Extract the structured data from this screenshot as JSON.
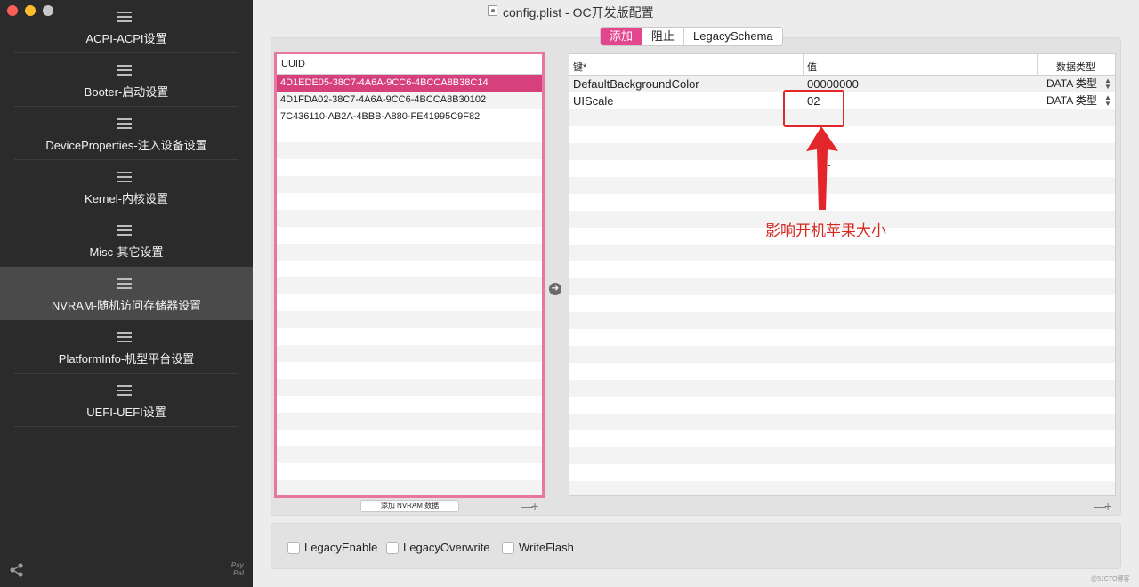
{
  "window": {
    "title": "config.plist - OC开发版配置"
  },
  "sidebar": {
    "items": [
      {
        "label": "ACPI-ACPI设置",
        "active": false
      },
      {
        "label": "Booter-启动设置",
        "active": false
      },
      {
        "label": "DeviceProperties-注入设备设置",
        "active": false
      },
      {
        "label": "Kernel-内核设置",
        "active": false
      },
      {
        "label": "Misc-其它设置",
        "active": false
      },
      {
        "label": "NVRAM-随机访问存储器设置",
        "active": true
      },
      {
        "label": "PlatformInfo-机型平台设置",
        "active": false
      },
      {
        "label": "UEFI-UEFI设置",
        "active": false
      }
    ],
    "paypal": "Pay Pal"
  },
  "tabs": [
    {
      "label": "添加",
      "active": true
    },
    {
      "label": "阻止",
      "active": false
    },
    {
      "label": "LegacySchema",
      "active": false
    }
  ],
  "uuid_table": {
    "header": "UUID",
    "rows": [
      "4D1EDE05-38C7-4A6A-9CC6-4BCCA8B38C14",
      "4D1FDA02-38C7-4A6A-9CC6-4BCCA8B30102",
      "7C436110-AB2A-4BBB-A880-FE41995C9F82"
    ],
    "selected_index": 0,
    "add_button": "添加 NVRAM 数据",
    "minus": "—",
    "plus": "+"
  },
  "kv_table": {
    "headers": {
      "key": "键*",
      "value": "值",
      "type": "数据类型"
    },
    "rows": [
      {
        "key": "DefaultBackgroundColor",
        "value": "00000000",
        "type": "DATA 类型"
      },
      {
        "key": "UIScale",
        "value": "02",
        "type": "DATA 类型"
      }
    ],
    "minus": "—",
    "plus": "+"
  },
  "annotation": {
    "text": "影响开机苹果大小",
    "color": "#d42a20"
  },
  "options": {
    "legacy_enable": "LegacyEnable",
    "legacy_overwrite": "LegacyOverwrite",
    "write_flash": "WriteFlash"
  },
  "watermark": "@51CTO博客",
  "colors": {
    "accent": "#e3458e",
    "selection": "#d6407c",
    "sidebar_bg": "#2b2b2b"
  }
}
